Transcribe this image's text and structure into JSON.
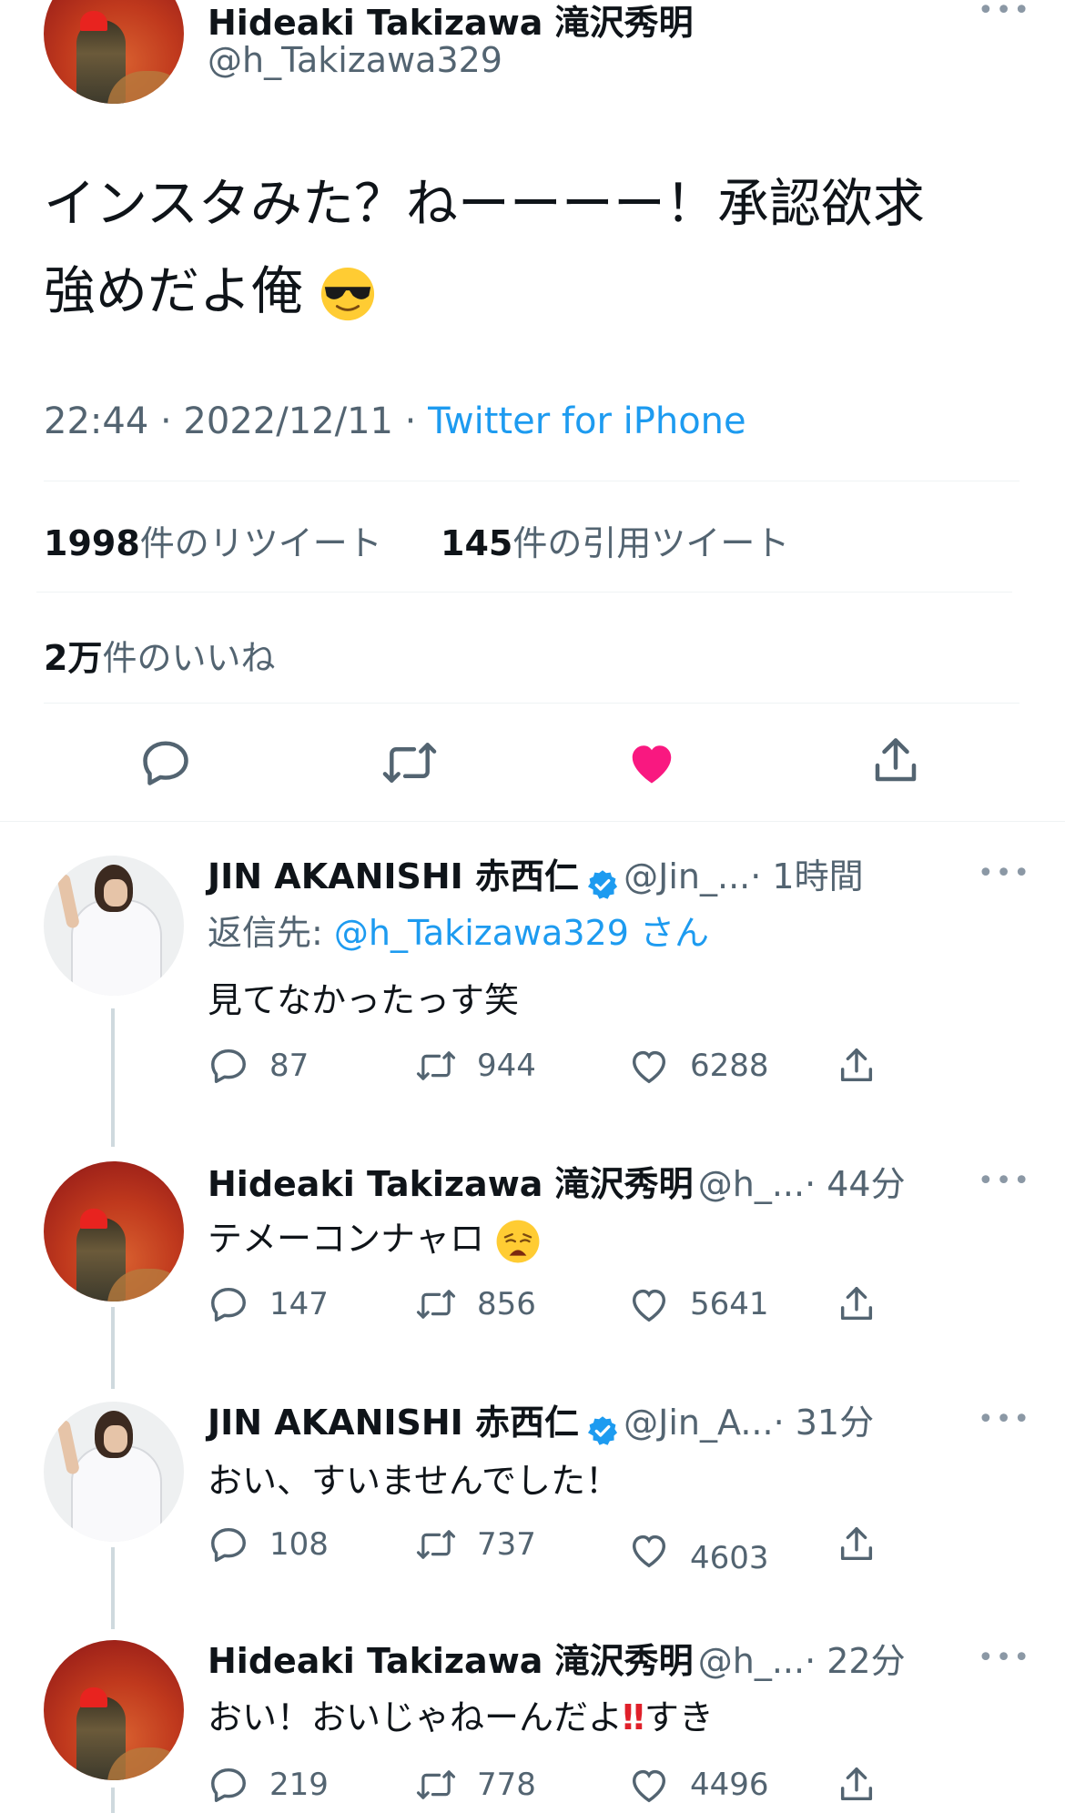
{
  "main_tweet": {
    "author_name": "Hideaki Takizawa 滝沢秀明",
    "author_handle": "@h_Takizawa329",
    "text_line1": "インスタみた？ねーーーー！承認欲求",
    "text_line2": "強めだよ俺",
    "text_emoji": "sunglasses-emoji",
    "time": "22:44 · 2022/12/11 · ",
    "source": "Twitter for iPhone",
    "retweets_count": "1998",
    "retweets_label": "件のリツイート",
    "quotes_count": "145",
    "quotes_label": "件の引用ツイート",
    "likes_count": "2万",
    "likes_label": "件のいいね",
    "liked": true
  },
  "replies": [
    {
      "author_name": "JIN AKANISHI 赤西仁",
      "verified": true,
      "handle": "@Jin_...",
      "time": "· 1時間",
      "reply_to_prefix": "返信先: ",
      "reply_to_handle": "@h_Takizawa329 さん",
      "text": "見てなかったっす笑",
      "replies": "87",
      "retweets": "944",
      "likes": "6288"
    },
    {
      "author_name": "Hideaki Takizawa 滝沢秀明",
      "verified": false,
      "handle": "@h_...",
      "time": "· 44分",
      "text": "テメーコンナャロ",
      "text_emoji": "weary-face-emoji",
      "replies": "147",
      "retweets": "856",
      "likes": "5641"
    },
    {
      "author_name": "JIN AKANISHI 赤西仁",
      "verified": true,
      "handle": "@Jin_A...",
      "time": "· 31分",
      "text": "おい、すいませんでした！",
      "replies": "108",
      "retweets": "737",
      "likes": "4603"
    },
    {
      "author_name": "Hideaki Takizawa 滝沢秀明",
      "verified": false,
      "handle": "@h_...",
      "time": "· 22分",
      "text_before": "おい！おいじゃねーんだよ",
      "text_emoji": "double-exclamation-emoji",
      "text_after": "すき",
      "replies": "219",
      "retweets": "778",
      "likes": "4496"
    }
  ],
  "colors": {
    "link": "#1d9bf0",
    "like_active": "#f91880",
    "secondary_text": "#536471",
    "verified": "#1d9bf0"
  }
}
